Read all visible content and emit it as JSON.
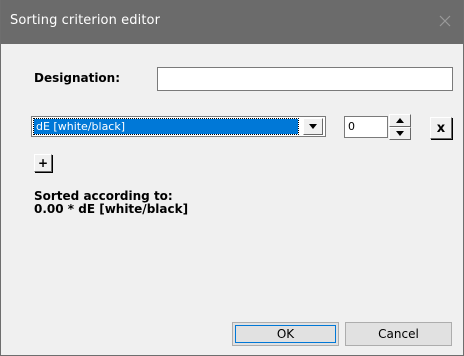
{
  "window": {
    "title": "Sorting criterion editor"
  },
  "designation": {
    "label": "Designation:",
    "value": ""
  },
  "criterion": {
    "selected": "dE [white/black]",
    "weight": "0"
  },
  "buttons": {
    "remove": "x",
    "add": "+",
    "ok": "OK",
    "cancel": "Cancel"
  },
  "sorted": {
    "heading": "Sorted according to:",
    "formula": "0.00 * dE [white/black]"
  },
  "icons": {
    "close": "close-icon",
    "dropdown": "dropdown-arrow-icon",
    "spin_up": "spin-up-arrow-icon",
    "spin_down": "spin-down-arrow-icon"
  },
  "colors": {
    "titlebar": "#6b6b6b",
    "selection": "#0078d7",
    "background": "#f0f0f0"
  }
}
